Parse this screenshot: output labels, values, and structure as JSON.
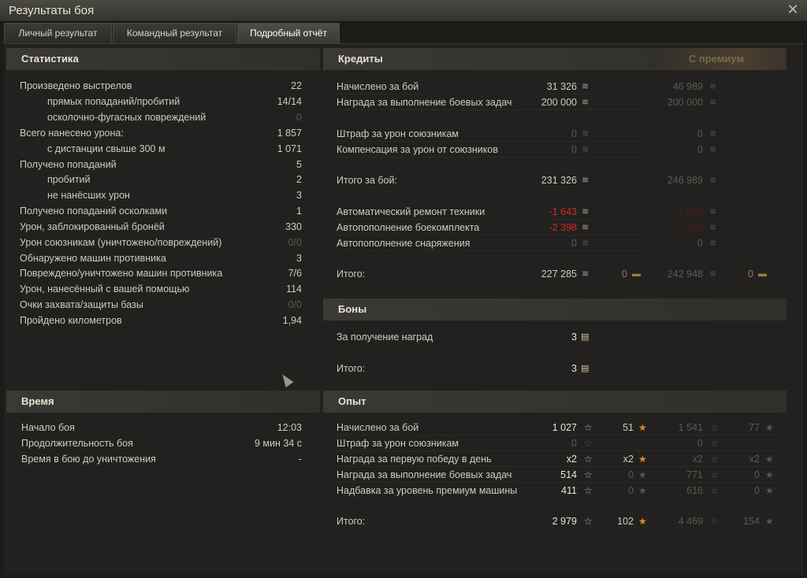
{
  "window": {
    "title": "Результаты боя",
    "close_icon": "close-icon"
  },
  "tabs": [
    {
      "label": "Личный результат"
    },
    {
      "label": "Командный результат"
    },
    {
      "label": "Подробный отчёт"
    }
  ],
  "stats": {
    "title": "Статистика",
    "rows": [
      {
        "label": "Произведено выстрелов",
        "value": "22",
        "indent": false,
        "dim": false
      },
      {
        "label": "прямых попаданий/пробитий",
        "value": "14/14",
        "indent": true,
        "dim": false
      },
      {
        "label": "осколочно-фугасных повреждений",
        "value": "0",
        "indent": true,
        "dim": true
      },
      {
        "label": "Всего нанесено урона:",
        "value": "1 857",
        "indent": false,
        "dim": false
      },
      {
        "label": "с дистанции свыше 300 м",
        "value": "1 071",
        "indent": true,
        "dim": false
      },
      {
        "label": "Получено попаданий",
        "value": "5",
        "indent": false,
        "dim": false
      },
      {
        "label": "пробитий",
        "value": "2",
        "indent": true,
        "dim": false
      },
      {
        "label": "не нанёсших урон",
        "value": "3",
        "indent": true,
        "dim": false
      },
      {
        "label": "Получено попаданий осколками",
        "value": "1",
        "indent": false,
        "dim": false
      },
      {
        "label": "Урон, заблокированный бронёй",
        "value": "330",
        "indent": false,
        "dim": false
      },
      {
        "label": "Урон союзникам (уничтожено/повреждений)",
        "value": "0/0",
        "indent": false,
        "dim": true
      },
      {
        "label": "Обнаружено машин противника",
        "value": "3",
        "indent": false,
        "dim": false
      },
      {
        "label": "Повреждено/уничтожено машин противника",
        "value": "7/6",
        "indent": false,
        "dim": false
      },
      {
        "label": "Урон, нанесённый с вашей помощью",
        "value": "114",
        "indent": false,
        "dim": false
      },
      {
        "label": "Очки захвата/защиты базы",
        "value": "0/0",
        "indent": false,
        "dim": true
      },
      {
        "label": "Пройдено километров",
        "value": "1,94",
        "indent": false,
        "dim": false
      }
    ]
  },
  "time": {
    "title": "Время",
    "rows": [
      {
        "label": "Начало боя",
        "value": "12:03"
      },
      {
        "label": "Продолжительность боя",
        "value": "9 мин 34 с"
      },
      {
        "label": "Время в бою до уничтожения",
        "value": "-"
      }
    ]
  },
  "credits": {
    "title": "Кредиты",
    "premium_label": "С премиум",
    "rows": [
      {
        "label": "Начислено за бой",
        "v1": "31 326",
        "v2": "",
        "v3": "46 989",
        "v4": "",
        "s1": "w",
        "s3": "d"
      },
      {
        "label": "Награда за выполнение боевых задач",
        "v1": "200 000",
        "v2": "",
        "v3": "200 000",
        "v4": "",
        "s1": "w",
        "s3": "d"
      },
      {
        "label": "Штраф за урон союзникам",
        "v1": "0",
        "v2": "",
        "v3": "0",
        "v4": "",
        "s1": "d",
        "s3": "d"
      },
      {
        "label": "Компенсация за урон от союзников",
        "v1": "0",
        "v2": "",
        "v3": "0",
        "v4": "",
        "s1": "d",
        "s3": "d"
      },
      {
        "label": "Итого за бой:",
        "v1": "231 326",
        "v2": "",
        "v3": "246 989",
        "v4": "",
        "s1": "w",
        "s3": "d"
      },
      {
        "label": "Автоматический ремонт техники",
        "v1": "-1 643",
        "v2": "",
        "v3": "-1 643",
        "v4": "",
        "s1": "r",
        "s3": "rd"
      },
      {
        "label": "Автопополнение боекомплекта",
        "v1": "-2 398",
        "v2": "",
        "v3": "-2 398",
        "v4": "",
        "s1": "r",
        "s3": "rd"
      },
      {
        "label": "Автопополнение снаряжения",
        "v1": "0",
        "v2": "",
        "v3": "0",
        "v4": "",
        "s1": "d",
        "s3": "d"
      },
      {
        "label": "Итого:",
        "v1": "227 285",
        "v2": "0",
        "v3": "242 948",
        "v4": "0",
        "s1": "w",
        "s3": "d"
      }
    ]
  },
  "bonds": {
    "title": "Боны",
    "rows": [
      {
        "label": "За получение наград",
        "value": "3"
      },
      {
        "label": "Итого:",
        "value": "3"
      }
    ]
  },
  "xp": {
    "title": "Опыт",
    "rows": [
      {
        "label": "Начислено за бой",
        "v1": "1 027",
        "v2": "51",
        "v3": "1 541",
        "v4": "77",
        "d1": false,
        "d2": false
      },
      {
        "label": "Штраф за урон союзникам",
        "v1": "0",
        "v2": "",
        "v3": "0",
        "v4": "",
        "d1": true,
        "d2": true
      },
      {
        "label": "Награда за первую победу в день",
        "v1": "x2",
        "v2": "x2",
        "v3": "x2",
        "v4": "x2",
        "d1": false,
        "d2": false
      },
      {
        "label": "Награда за выполнение боевых задач",
        "v1": "514",
        "v2": "0",
        "v3": "771",
        "v4": "0",
        "d1": false,
        "d2": true
      },
      {
        "label": "Надбавка за уровень премиум машины",
        "v1": "411",
        "v2": "0",
        "v3": "616",
        "v4": "0",
        "d1": false,
        "d2": true
      },
      {
        "label": "Итого:",
        "v1": "2 979",
        "v2": "102",
        "v3": "4 469",
        "v4": "154",
        "d1": false,
        "d2": false
      }
    ]
  }
}
